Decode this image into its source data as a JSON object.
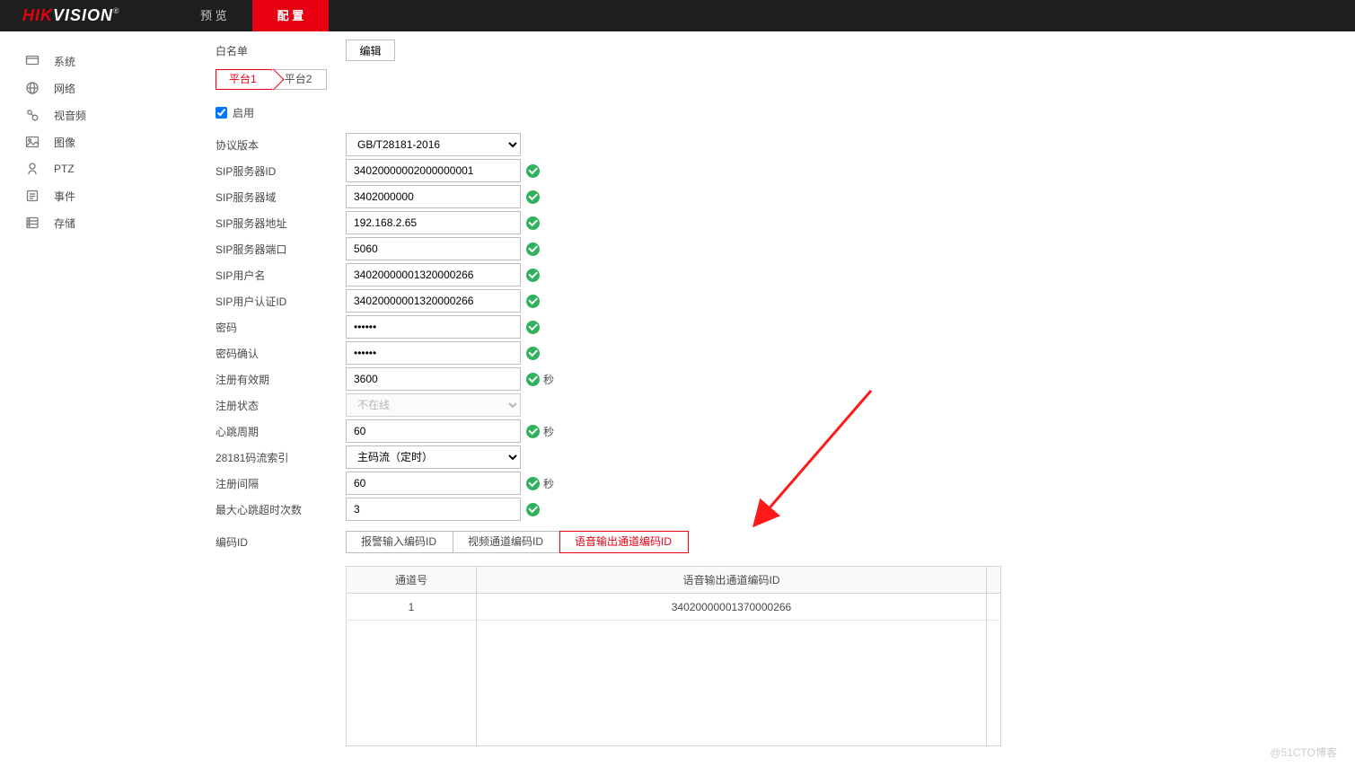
{
  "logo": {
    "part1": "HIK",
    "part2": "VISION",
    "reg": "®"
  },
  "topnav": {
    "preview": "预 览",
    "config": "配 置"
  },
  "sidebar": {
    "items": [
      {
        "label": "系统"
      },
      {
        "label": "网络"
      },
      {
        "label": "视音频"
      },
      {
        "label": "图像"
      },
      {
        "label": "PTZ"
      },
      {
        "label": "事件"
      },
      {
        "label": "存储"
      }
    ]
  },
  "section": {
    "whitelist_label": "白名单",
    "edit_btn": "编辑"
  },
  "platforms": {
    "tab1": "平台1",
    "tab2": "平台2"
  },
  "enable": {
    "label": "启用"
  },
  "fields": {
    "protocol_version": {
      "label": "协议版本",
      "value": "GB/T28181-2016"
    },
    "sip_server_id": {
      "label": "SIP服务器ID",
      "value": "34020000002000000001"
    },
    "sip_server_domain": {
      "label": "SIP服务器域",
      "value": "3402000000"
    },
    "sip_server_addr": {
      "label": "SIP服务器地址",
      "value": "192.168.2.65"
    },
    "sip_server_port": {
      "label": "SIP服务器端口",
      "value": "5060"
    },
    "sip_user": {
      "label": "SIP用户名",
      "value": "34020000001320000266"
    },
    "sip_auth_id": {
      "label": "SIP用户认证ID",
      "value": "34020000001320000266"
    },
    "password": {
      "label": "密码",
      "value": "••••••"
    },
    "password_confirm": {
      "label": "密码确认",
      "value": "••••••"
    },
    "reg_valid": {
      "label": "注册有效期",
      "value": "3600",
      "unit": "秒"
    },
    "reg_status": {
      "label": "注册状态",
      "value": "不在线"
    },
    "heartbeat": {
      "label": "心跳周期",
      "value": "60",
      "unit": "秒"
    },
    "stream_index": {
      "label": "28181码流索引",
      "value": "主码流（定时）"
    },
    "reg_interval": {
      "label": "注册间隔",
      "value": "60",
      "unit": "秒"
    },
    "max_hb_timeout": {
      "label": "最大心跳超时次数",
      "value": "3"
    },
    "enc_id": {
      "label": "编码ID"
    }
  },
  "enc_tabs": {
    "alarm_in": "报警输入编码ID",
    "video_ch": "视频通道编码ID",
    "audio_out": "语音输出通道编码ID"
  },
  "table": {
    "header_channel": "通道号",
    "header_value": "语音输出通道编码ID",
    "rows": [
      {
        "channel": "1",
        "value": "34020000001370000266"
      }
    ]
  },
  "watermark": "@51CTO博客"
}
